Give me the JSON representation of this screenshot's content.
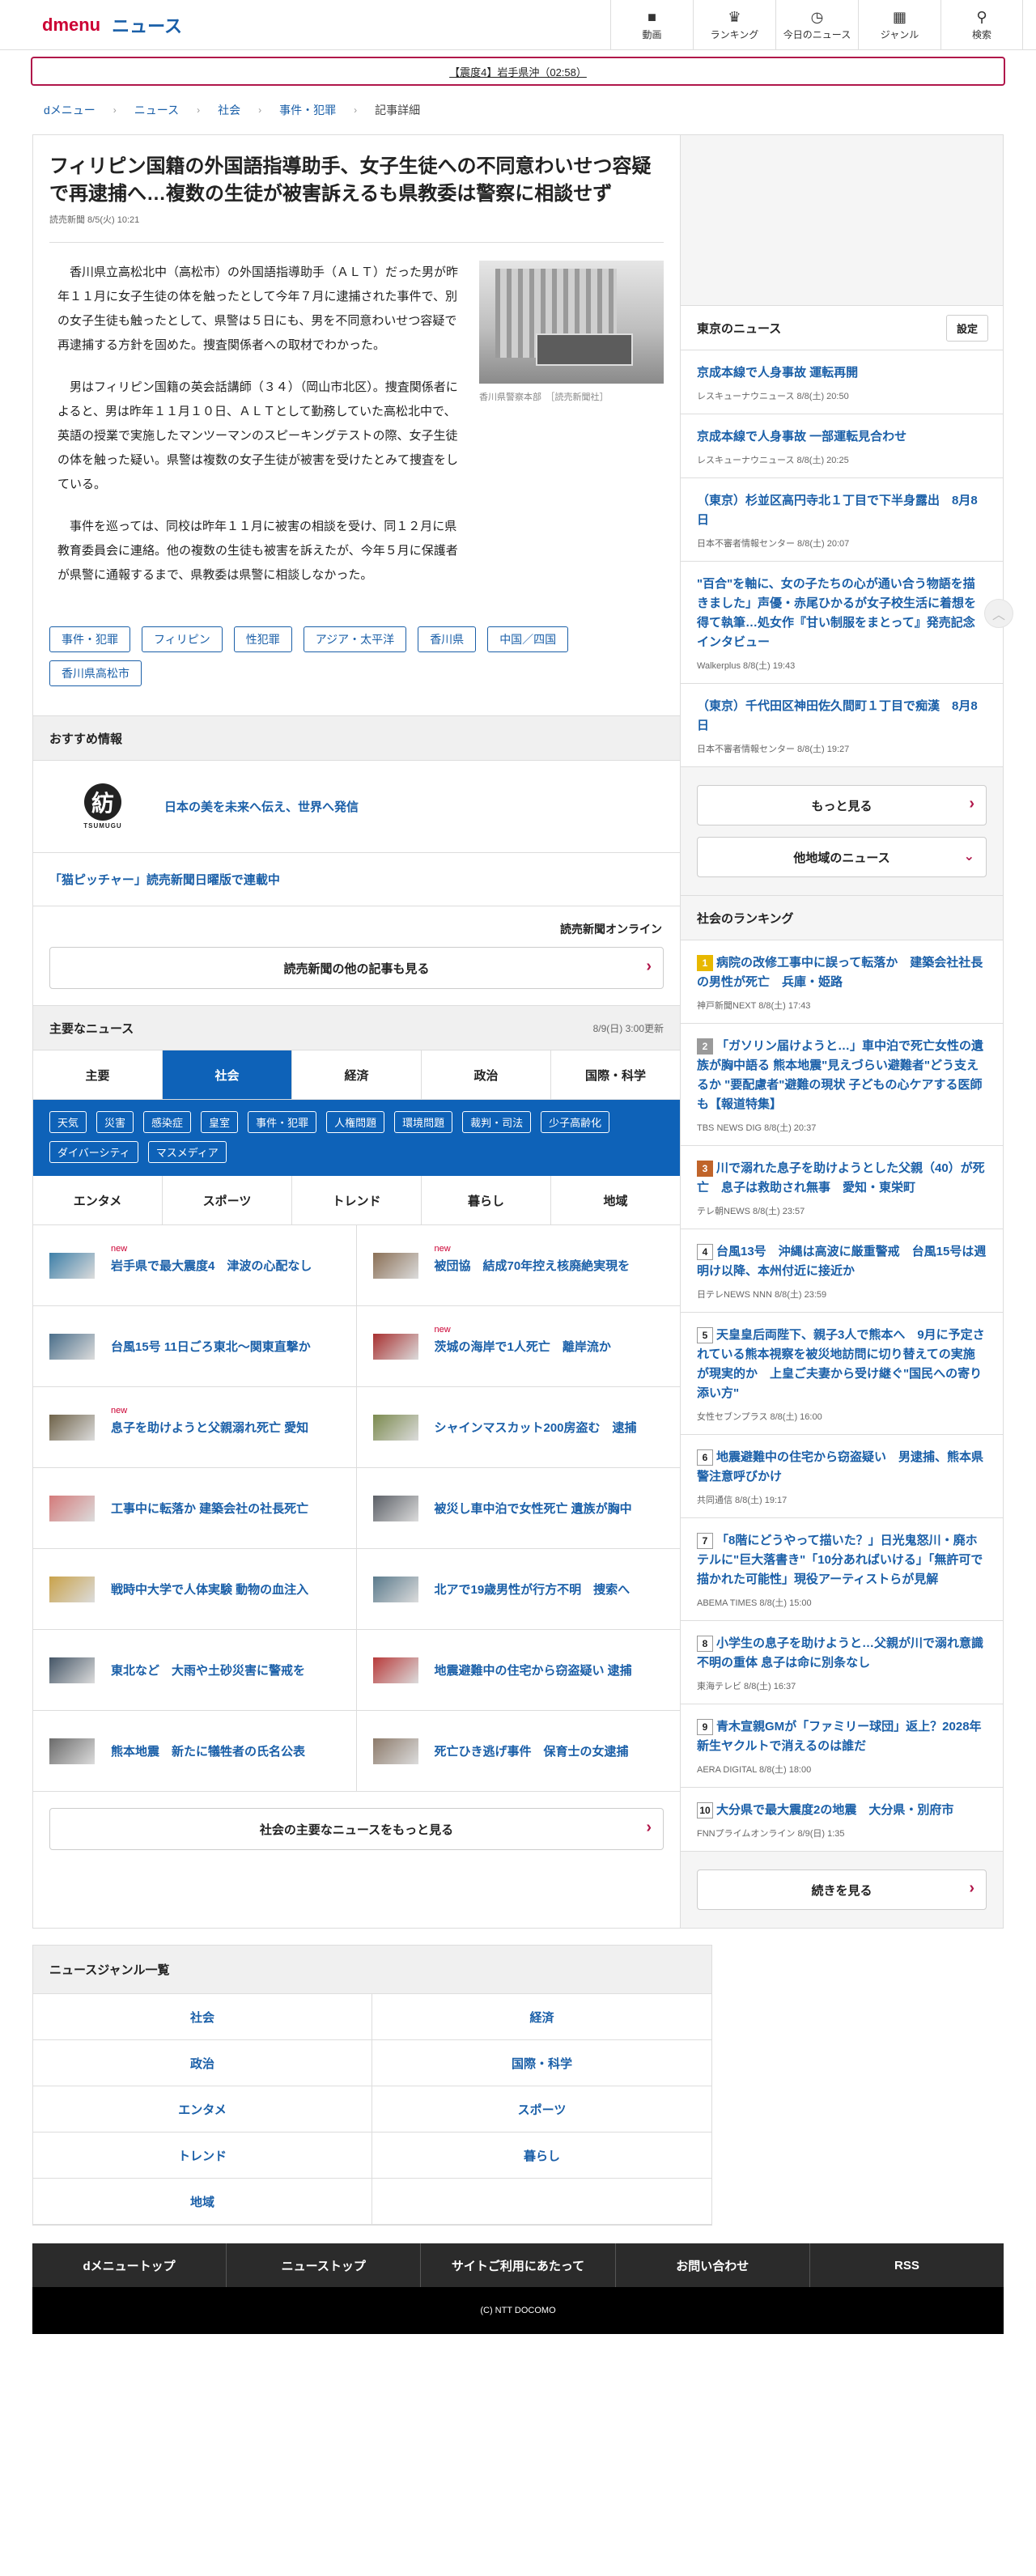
{
  "header": {
    "logo": "dmenu",
    "section": "ニュース",
    "nav": [
      {
        "label": "動画",
        "icon": "video-icon",
        "glyph": "■"
      },
      {
        "label": "ランキング",
        "icon": "trophy-icon",
        "glyph": "♛"
      },
      {
        "label": "今日のニュース",
        "icon": "clock-icon",
        "glyph": "◷"
      },
      {
        "label": "ジャンル",
        "icon": "grid-icon",
        "glyph": "▦"
      },
      {
        "label": "検索",
        "icon": "search-icon",
        "glyph": "⚲"
      }
    ]
  },
  "alert": "【震度4】岩手県沖（02:58）",
  "breadcrumb": [
    "dメニュー",
    "ニュース",
    "社会",
    "事件・犯罪",
    "記事詳細"
  ],
  "article": {
    "title": "フィリピン国籍の外国語指導助手、女子生徒への不同意わいせつ容疑で再逮捕へ…複数の生徒が被害訴えるも県教委は警察に相談せず",
    "meta": "読売新聞 8/5(火) 10:21",
    "paragraphs": [
      "香川県立高松北中（高松市）の外国語指導助手（ＡＬＴ）だった男が昨年１１月に女子生徒の体を触ったとして今年７月に逮捕された事件で、別の女子生徒も触ったとして、県警は５日にも、男を不同意わいせつ容疑で再逮捕する方針を固めた。捜査関係者への取材でわかった。",
      "男はフィリピン国籍の英会話講師（３４）（岡山市北区）。捜査関係者によると、男は昨年１１月１０日、ＡＬＴとして勤務していた高松北中で、英語の授業で実施したマンツーマンのスピーキングテストの際、女子生徒の体を触った疑い。県警は複数の女子生徒が被害を受けたとみて捜査をしている。",
      "事件を巡っては、同校は昨年１１月に被害の相談を受け、同１２月に県教育委員会に連絡。他の複数の生徒も被害を訴えたが、今年５月に保護者が県警に通報するまで、県教委は県警に相談しなかった。"
    ],
    "photo_caption": "香川県警察本部　［読売新聞社］",
    "tags": [
      "事件・犯罪",
      "フィリピン",
      "性犯罪",
      "アジア・太平洋",
      "香川県",
      "中国／四国",
      "香川県高松市"
    ]
  },
  "recommend": {
    "heading": "おすすめ情報",
    "tsumugi_caption": "TSUMUGU",
    "tsumugi_glyph": "紡",
    "item1": "日本の美を未来へ伝え、世界へ発信",
    "item2": "「猫ピッチャー」読売新聞日曜版で連載中",
    "yomiuri_logo": "読売新聞オンライン",
    "more_label": "読売新聞の他の記事も見る"
  },
  "major_news": {
    "heading": "主要なニュース",
    "updated": "8/9(日) 3:00更新",
    "tabs_row1": [
      "主要",
      "社会",
      "経済",
      "政治",
      "国際・科学"
    ],
    "active_tab": "社会",
    "subtags": [
      "天気",
      "災害",
      "感染症",
      "皇室",
      "事件・犯罪",
      "人権問題",
      "環境問題",
      "裁判・司法",
      "少子高齢化",
      "ダイバーシティ",
      "マスメディア"
    ],
    "tabs_row2": [
      "エンタメ",
      "スポーツ",
      "トレンド",
      "暮らし",
      "地域"
    ],
    "new_label": "new",
    "items": [
      {
        "title": "岩手県で最大震度4　津波の心配なし",
        "new": true,
        "thumb": "#3d7fa8"
      },
      {
        "title": "被団協　結成70年控え核廃絶実現を",
        "new": true,
        "thumb": "#8a6f55"
      },
      {
        "title": "台風15号 11日ごろ東北〜関東直撃か",
        "new": false,
        "thumb": "#4a6e8a"
      },
      {
        "title": "茨城の海岸で1人死亡　離岸流か",
        "new": true,
        "thumb": "#a83030"
      },
      {
        "title": "息子を助けようと父親溺れ死亡 愛知",
        "new": true,
        "thumb": "#6e6248"
      },
      {
        "title": "シャインマスカット200房盗む　逮捕",
        "new": false,
        "thumb": "#7b8a4e"
      },
      {
        "title": "工事中に転落か 建築会社の社長死亡",
        "new": false,
        "thumb": "#d47a7a"
      },
      {
        "title": "被災し車中泊で女性死亡 遺族が胸中",
        "new": false,
        "thumb": "#5b5f66"
      },
      {
        "title": "戦時中大学で人体実験 動物の血注入",
        "new": false,
        "thumb": "#c9a24a"
      },
      {
        "title": "北アで19歳男性が行方不明　捜索へ",
        "new": false,
        "thumb": "#5a7a8c"
      },
      {
        "title": "東北など　大雨や土砂災害に警戒を",
        "new": false,
        "thumb": "#445566"
      },
      {
        "title": "地震避難中の住宅から窃盗疑い 逮捕",
        "new": false,
        "thumb": "#b83a3a"
      },
      {
        "title": "熊本地震　新たに犠牲者の氏名公表",
        "new": false,
        "thumb": "#6a6a6a"
      },
      {
        "title": "死亡ひき逃げ事件　保育士の女逮捕",
        "new": false,
        "thumb": "#8c7a6a"
      }
    ],
    "more_label": "社会の主要なニュースをもっと見る"
  },
  "tokyo_news": {
    "heading": "東京のニュース",
    "settings_label": "設定",
    "items": [
      {
        "title": "京成本線で人身事故 運転再開",
        "source": "レスキューナウニュース 8/8(土) 20:50"
      },
      {
        "title": "京成本線で人身事故 一部運転見合わせ",
        "source": "レスキューナウニュース 8/8(土) 20:25"
      },
      {
        "title": "（東京）杉並区高円寺北１丁目で下半身露出　8月8日",
        "source": "日本不審者情報センター 8/8(土) 20:07"
      },
      {
        "title": "\"百合\"を軸に、女の子たちの心が通い合う物語を描きました」声優・赤尾ひかるが女子校生活に着想を得て執筆…処女作『甘い制服をまとって』発売記念インタビュー",
        "source": "Walkerplus 8/8(土) 19:43"
      },
      {
        "title": "（東京）千代田区神田佐久間町１丁目で痴漢　8月8日",
        "source": "日本不審者情報センター 8/8(土) 19:27"
      }
    ],
    "more_label": "もっと見る",
    "other_label": "他地域のニュース"
  },
  "ranking": {
    "heading": "社会のランキング",
    "items": [
      {
        "rank": "1",
        "title": "病院の改修工事中に誤って転落か　建築会社社長の男性が死亡　兵庫・姫路",
        "source": "神戸新聞NEXT 8/8(土) 17:43"
      },
      {
        "rank": "2",
        "title": "「ガソリン届けようと…」車中泊で死亡女性の遺族が胸中語る 熊本地震\"見えづらい避難者\"どう支えるか \"要配慮者\"避難の現状 子どもの心ケアする医師も【報道特集】",
        "source": "TBS NEWS DIG 8/8(土) 20:37"
      },
      {
        "rank": "3",
        "title": "川で溺れた息子を助けようとした父親（40）が死亡　息子は救助され無事　愛知・東栄町",
        "source": "テレ朝NEWS 8/8(土) 23:57"
      },
      {
        "rank": "4",
        "title": "台風13号　沖縄は高波に厳重警戒　台風15号は週明け以降、本州付近に接近か",
        "source": "日テレNEWS NNN 8/8(土) 23:59"
      },
      {
        "rank": "5",
        "title": "天皇皇后両陛下、親子3人で熊本へ　9月に予定されている熊本視察を被災地訪問に切り替えての実施が現実的か　上皇ご夫妻から受け継ぐ\"国民への寄り添い方\"",
        "source": "女性セブンプラス 8/8(土) 16:00"
      },
      {
        "rank": "6",
        "title": "地震避難中の住宅から窃盗疑い　男逮捕、熊本県警注意呼びかけ",
        "source": "共同通信 8/8(土) 19:17"
      },
      {
        "rank": "7",
        "title": "「8階にどうやって描いた？」日光鬼怒川・廃ホテルに\"巨大落書き\"「10分あればいける」「無許可で描かれた可能性」現役アーティストらが見解",
        "source": "ABEMA TIMES 8/8(土) 15:00"
      },
      {
        "rank": "8",
        "title": "小学生の息子を助けようと…父親が川で溺れ意識不明の重体 息子は命に別条なし",
        "source": "東海テレビ 8/8(土) 16:37"
      },
      {
        "rank": "9",
        "title": "青木宣親GMが「ファミリー球団」返上？2028年新生ヤクルトで消えるのは誰だ",
        "source": "AERA DIGITAL 8/8(土) 18:00"
      },
      {
        "rank": "10",
        "title": "大分県で最大震度2の地震　大分県・別府市",
        "source": "FNNプライムオンライン 8/9(日) 1:35"
      }
    ],
    "more_label": "続きを見る"
  },
  "genres": {
    "heading": "ニュースジャンル一覧",
    "items": [
      "社会",
      "経済",
      "政治",
      "国際・科学",
      "エンタメ",
      "スポーツ",
      "トレンド",
      "暮らし",
      "地域"
    ]
  },
  "footer": {
    "nav": [
      "dメニュートップ",
      "ニューストップ",
      "サイトご利用にあたって",
      "お問い合わせ",
      "RSS"
    ],
    "copyright": "(C) NTT DOCOMO"
  },
  "colors": {
    "brand_red": "#cc0033",
    "link_blue": "#1a5fa8",
    "active_tab_blue": "#0e62b8",
    "alert_border": "#b0164a"
  }
}
